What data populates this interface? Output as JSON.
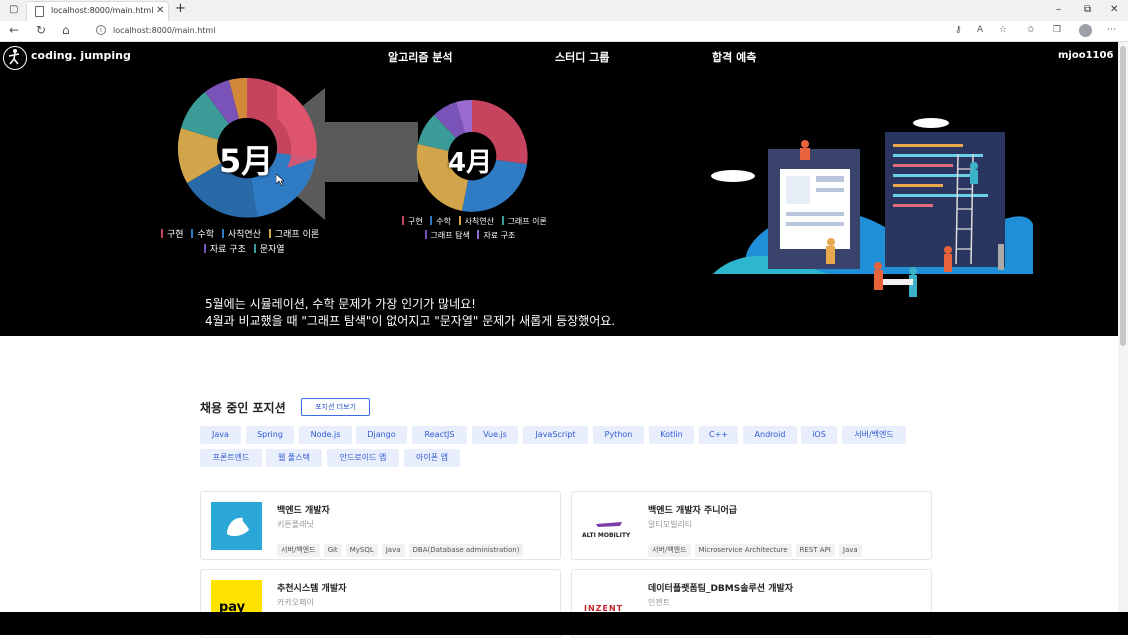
{
  "browser": {
    "tab_title": "localhost:8000/main.html",
    "url": "localhost:8000/main.html"
  },
  "nav": {
    "logo": "coding. jumping",
    "items": [
      "알고리즘 분석",
      "스터디 그룹",
      "합격 예측"
    ],
    "user": "mjoo1106"
  },
  "hero": {
    "may_label": "5月",
    "april_label": "4月",
    "may_legend": [
      "구현",
      "수학",
      "사칙연산",
      "그래프 이론",
      "자료 구조",
      "문자열"
    ],
    "april_legend": [
      "구현",
      "수학",
      "사칙연산",
      "그래프 이론",
      "그래프 탐색",
      "자료 구조"
    ],
    "summary_line1": "5월에는 시뮬레이션, 수학 문제가 가장 인기가 많네요!",
    "summary_line2": "4월과 비교했을 때 \"그래프 탐색\"이 없어지고 \"문자열\" 문제가 새롭게 등장했어요.",
    "colors": {
      "red": "#c7445f",
      "blue": "#2f7bc4",
      "yellow": "#d3a54a",
      "teal": "#3b9c97",
      "purple": "#7a53b8",
      "orange": "#d3893a"
    }
  },
  "positions": {
    "title": "채용 중인 포지션",
    "more_button": "포지션 더보기",
    "tags": [
      "Java",
      "Spring",
      "Node.js",
      "Django",
      "ReactJS",
      "Vue.js",
      "JavaScript",
      "Python",
      "Kotlin",
      "C++",
      "Android",
      "iOS",
      "서버/백엔드",
      "프론트엔드",
      "웹 풀스택",
      "안드로이드 앱",
      "아이폰 앱"
    ],
    "jobs": [
      {
        "title": "백엔드 개발자",
        "company": "키튼플래닛",
        "skills": [
          "서버/백엔드",
          "Git",
          "MySQL",
          "Java",
          "DBA(Database administration)"
        ]
      },
      {
        "title": "백엔드 개발자 주니어급",
        "company": "알티모빌리티",
        "logo_text": "ALTI MOBILITY",
        "skills": [
          "서버/백엔드",
          "Microservice Architecture",
          "REST API",
          "Java"
        ]
      },
      {
        "title": "추천시스템 개발자",
        "company": "카카오페이",
        "logo_text": "pay",
        "skills": []
      },
      {
        "title": "데이터플랫폼팀_DBMS솔루션 개발자",
        "company": "인젠트",
        "logo_text": "INZENT",
        "skills": []
      }
    ]
  }
}
